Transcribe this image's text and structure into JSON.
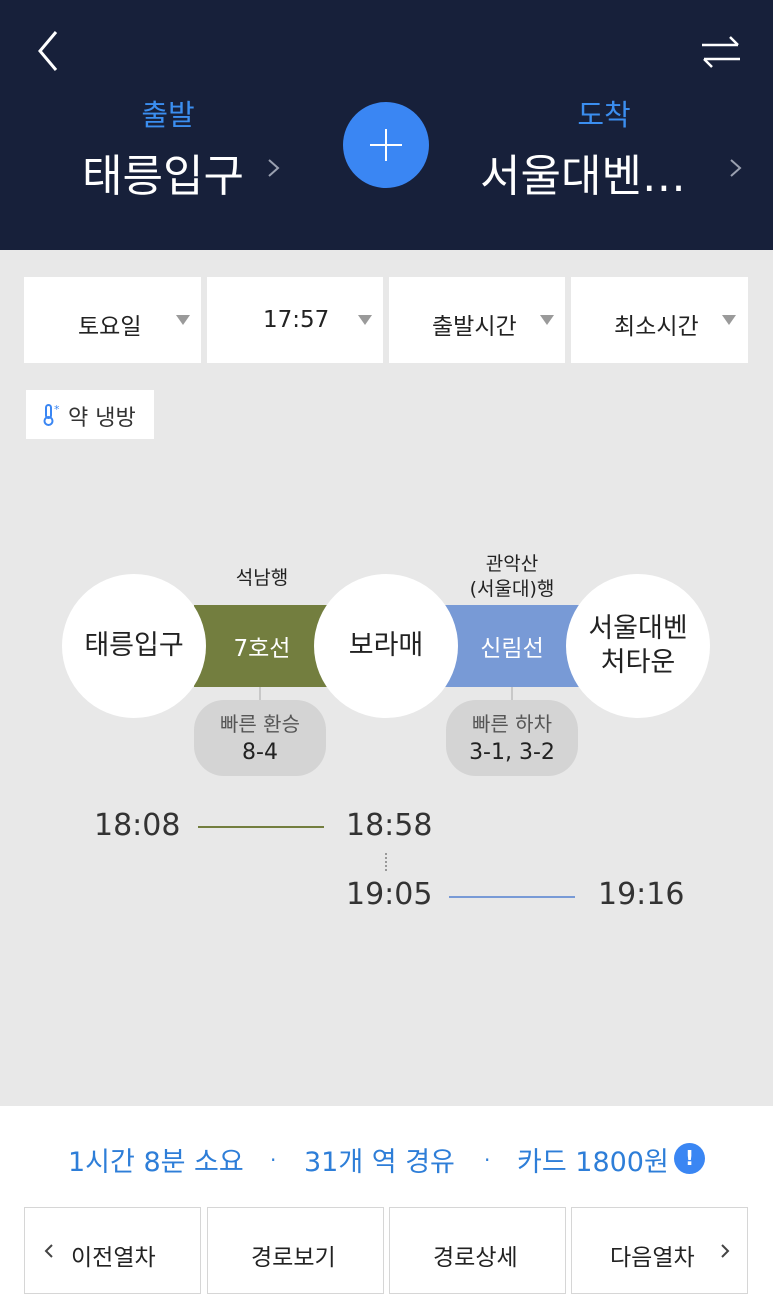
{
  "header": {
    "departure_label": "출발",
    "departure_station": "태릉입구",
    "arrival_label": "도착",
    "arrival_station": "서울대벤…",
    "back_icon": "chevron-left-icon",
    "swap_icon": "swap-arrows-icon",
    "add_icon": "plus-icon"
  },
  "filters": [
    {
      "label": "토요일"
    },
    {
      "label": "17:57"
    },
    {
      "label": "출발시간"
    },
    {
      "label": "최소시간"
    }
  ],
  "cooling": {
    "icon": "thermometer-icon",
    "label": "약 냉방"
  },
  "route": {
    "stations": [
      "태릉입구",
      "보라매",
      "서울대벤\n처타운"
    ],
    "lines": [
      {
        "name": "7호선",
        "direction": "석남행",
        "color": "#737e3f",
        "tip_label": "빠른 환승",
        "tip_value": "8-4"
      },
      {
        "name": "신림선",
        "direction": "관악산\n(서울대)행",
        "color": "#789ad6",
        "tip_label": "빠른 하차",
        "tip_value": "3-1, 3-2"
      }
    ],
    "times": {
      "depart": "18:08",
      "transfer_arrive": "18:58",
      "transfer_depart": "19:05",
      "arrive": "19:16"
    }
  },
  "summary": {
    "duration": "1시간 8분 소요",
    "stations": "31개 역 경유",
    "fare": "카드 1800원",
    "separator": "·",
    "info_icon": "info-icon",
    "info_glyph": "!",
    "color": "#2e7ed8"
  },
  "nav": {
    "prev": "이전열차",
    "route_view": "경로보기",
    "route_detail": "경로상세",
    "next": "다음열차"
  }
}
